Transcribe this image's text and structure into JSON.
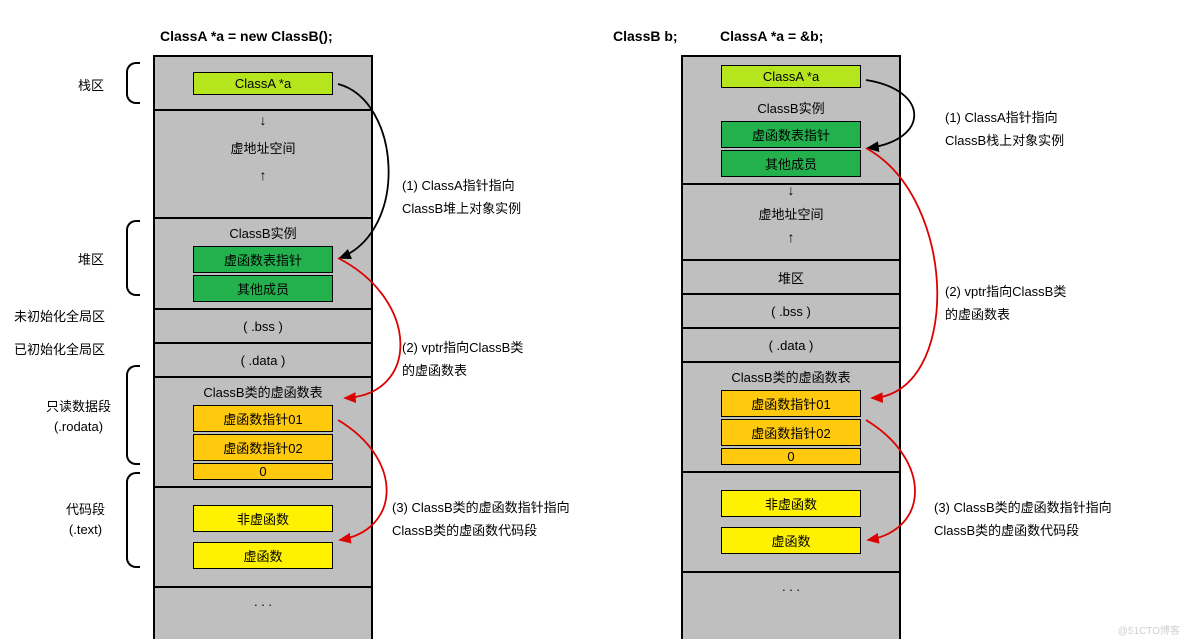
{
  "titles": {
    "left": "ClassA *a = new ClassB();",
    "right_a": "ClassB b;",
    "right_b": "ClassA *a = &b;"
  },
  "regions": {
    "stack": "栈区",
    "heap": "堆区",
    "bss_label": "未初始化全局区",
    "data_label": "已初始化全局区",
    "rodata_l1": "只读数据段",
    "rodata_l2": "(.rodata)",
    "text_l1": "代码段",
    "text_l2": "(.text)"
  },
  "left": {
    "ptr": "ClassA *a",
    "vspace": "虚地址空间",
    "classb_instance_title": "ClassB实例",
    "vtable_ptr": "虚函数表指针",
    "other_members": "其他成员",
    "bss": "( .bss )",
    "data": "( .data )",
    "vtable_title": "ClassB类的虚函数表",
    "vfptr01": "虚函数指针01",
    "vfptr02": "虚函数指针02",
    "vf_zero": "0",
    "nonvirt": "非虚函数",
    "virt": "虚函数"
  },
  "right": {
    "ptr": "ClassA *a",
    "classb_instance_title": "ClassB实例",
    "vtable_ptr": "虚函数表指针",
    "other_members": "其他成员",
    "vspace": "虚地址空间",
    "heap_label": "堆区",
    "bss": "( .bss )",
    "data": "( .data )",
    "vtable_title": "ClassB类的虚函数表",
    "vfptr01": "虚函数指针01",
    "vfptr02": "虚函数指针02",
    "vf_zero": "0",
    "nonvirt": "非虚函数",
    "virt": "虚函数"
  },
  "annos": {
    "left1_a": "(1) ClassA指针指向",
    "left1_b": "ClassB堆上对象实例",
    "left2_a": "(2) vptr指向ClassB类",
    "left2_b": "的虚函数表",
    "left3_a": "(3) ClassB类的虚函数指针指向",
    "left3_b": "ClassB类的虚函数代码段",
    "right1_a": "(1) ClassA指针指向",
    "right1_b": "ClassB栈上对象实例",
    "right2_a": "(2) vptr指向ClassB类",
    "right2_b": "的虚函数表",
    "right3_a": "(3) ClassB类的虚函数指针指向",
    "right3_b": "ClassB类的虚函数代码段"
  },
  "ellipsis": ". . .",
  "watermark": "@51CTO博客"
}
